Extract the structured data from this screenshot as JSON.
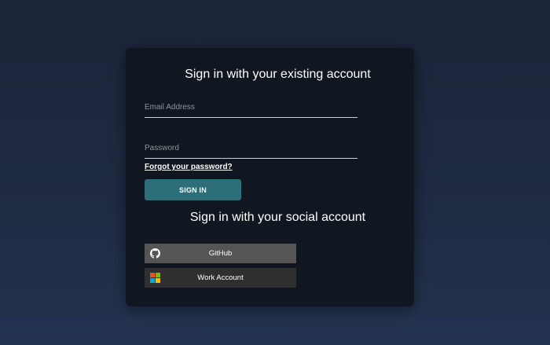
{
  "existing_account": {
    "heading": "Sign in with your existing account",
    "email_placeholder": "Email Address",
    "email_value": "",
    "password_placeholder": "Password",
    "password_value": "",
    "forgot_link": "Forgot your password?",
    "sign_in_button": "SIGN IN"
  },
  "social_account": {
    "heading": "Sign in with your social account",
    "providers": [
      {
        "label": "GitHub",
        "icon": "github-icon",
        "background": "#555555"
      },
      {
        "label": "Work Account",
        "icon": "microsoft-icon",
        "background": "#2f2f2f"
      }
    ]
  },
  "colors": {
    "accent": "#2e6e79",
    "card": "#111720",
    "microsoft": [
      "#f25022",
      "#7fba00",
      "#00a4ef",
      "#ffb900"
    ]
  }
}
